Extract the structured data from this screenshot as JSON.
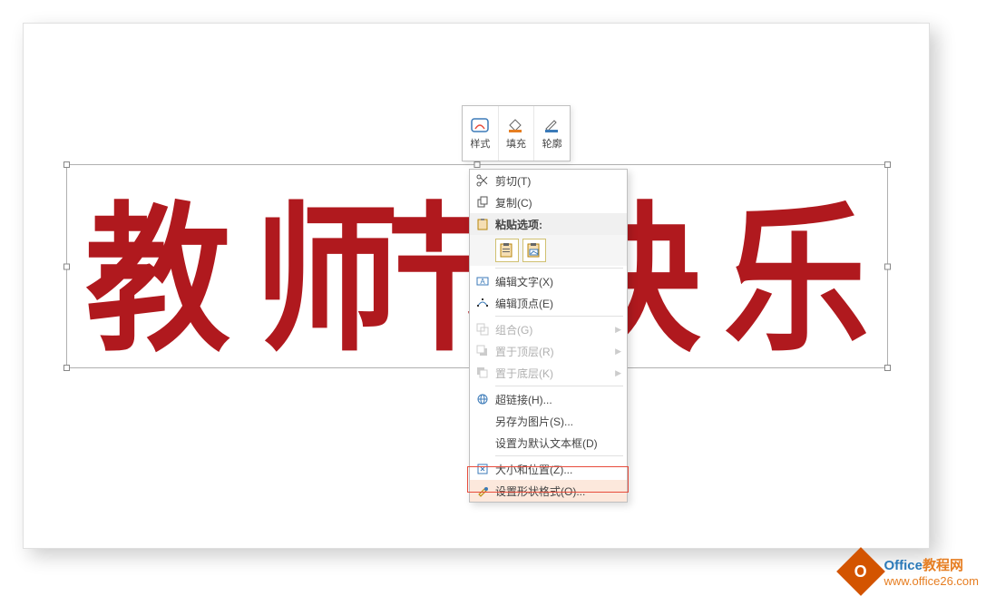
{
  "wordart_text": "教师节快乐",
  "wordart_chars": [
    "教",
    "师",
    "节",
    "快",
    "乐"
  ],
  "mini_toolbar": {
    "style": "样式",
    "fill": "填充",
    "outline": "轮廓"
  },
  "context_menu": {
    "cut": "剪切(T)",
    "copy": "复制(C)",
    "paste_header": "粘贴选项:",
    "edit_text": "编辑文字(X)",
    "edit_points": "编辑顶点(E)",
    "group": "组合(G)",
    "bring_front": "置于顶层(R)",
    "send_back": "置于底层(K)",
    "hyperlink": "超链接(H)...",
    "save_as_picture": "另存为图片(S)...",
    "set_default_textbox": "设置为默认文本框(D)",
    "size_position": "大小和位置(Z)...",
    "format_shape": "设置形状格式(O)..."
  },
  "watermark": {
    "brand1": "Office",
    "brand2": "教程网",
    "url": "www.office26.com"
  }
}
